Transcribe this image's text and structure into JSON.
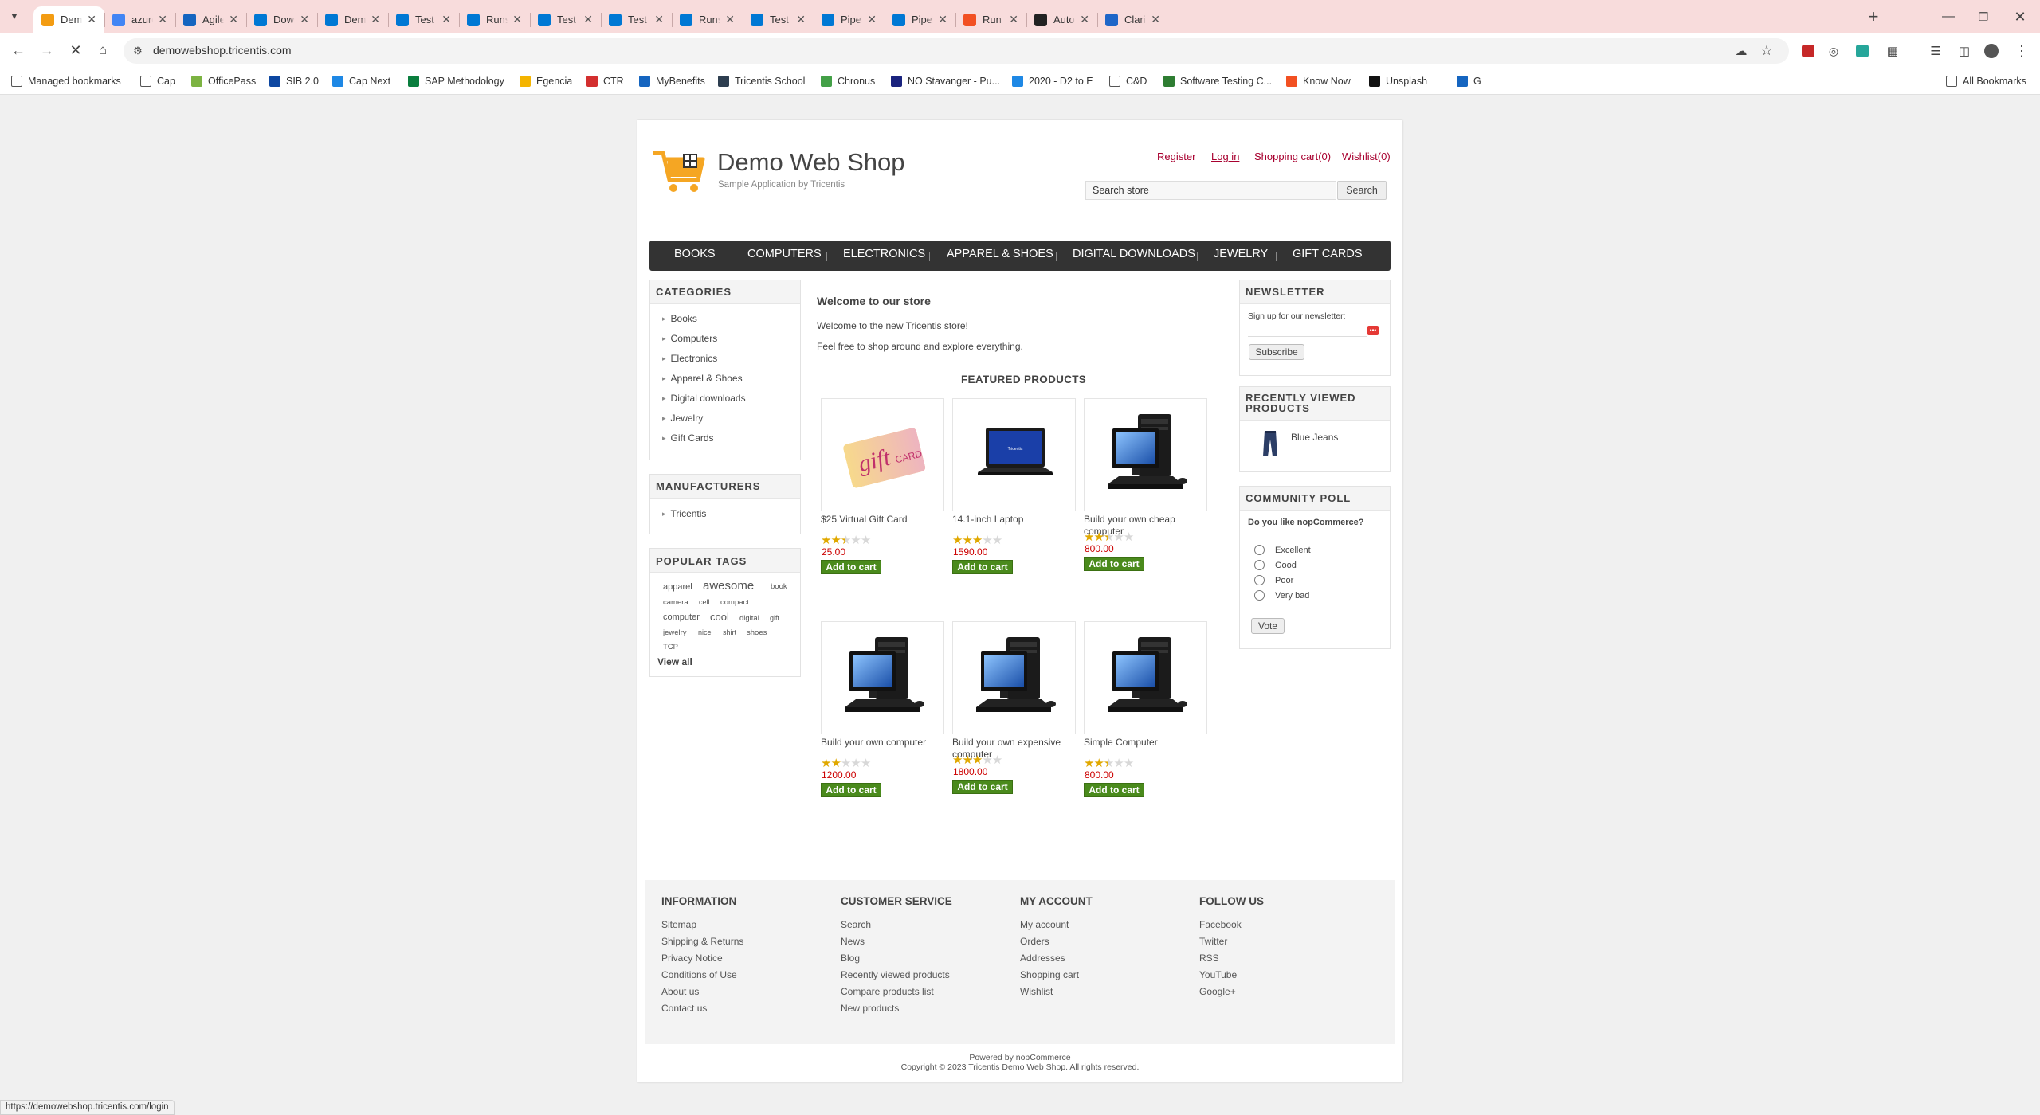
{
  "browser": {
    "tabs": [
      {
        "title": "Demo Web Shop",
        "icon": "shopping-cart-icon",
        "color": "#f39c12"
      },
      {
        "title": "azure devops",
        "icon": "google-icon",
        "color": "#4285f4"
      },
      {
        "title": "Agile Test Practices",
        "icon": "globe-icon",
        "color": "#1565c0"
      },
      {
        "title": "Download - Tricentis",
        "icon": "download-icon",
        "color": "#0078d4"
      },
      {
        "title": "Demo - Repos",
        "icon": "azure-devops-icon",
        "color": "#0078d4"
      },
      {
        "title": "Test plans - Tests",
        "icon": "azure-devops-icon",
        "color": "#0078d4"
      },
      {
        "title": "Runs - Test Plans",
        "icon": "azure-devops-icon",
        "color": "#0078d4"
      },
      {
        "title": "Test plans - Tests",
        "icon": "azure-devops-icon",
        "color": "#0078d4"
      },
      {
        "title": "Test plans - Tests",
        "icon": "azure-devops-icon",
        "color": "#0078d4"
      },
      {
        "title": "Runs - Test Plans",
        "icon": "azure-devops-icon",
        "color": "#0078d4"
      },
      {
        "title": "Test plans - Tests",
        "icon": "azure-devops-icon",
        "color": "#0078d4"
      },
      {
        "title": "Pipelines - Runs",
        "icon": "azure-devops-icon",
        "color": "#0078d4"
      },
      {
        "title": "Pipelines - Runs",
        "icon": "azure-devops-icon",
        "color": "#0078d4"
      },
      {
        "title": "Run automated tests",
        "icon": "microsoft-icon",
        "color": "#f25022"
      },
      {
        "title": "AutoTest/Demo",
        "icon": "github-icon",
        "color": "#222222"
      },
      {
        "title": "Clarity PPM",
        "icon": "clarity-icon",
        "color": "#1e66c8"
      }
    ],
    "url": "demowebshop.tricentis.com",
    "status_url": "https://demowebshop.tricentis.com/login",
    "bookmarks": [
      {
        "label": "Managed bookmarks",
        "icon": "folder-icon",
        "color": "#555555"
      },
      {
        "label": "Cap",
        "icon": "folder-icon",
        "color": "#555555"
      },
      {
        "label": "OfficePass",
        "icon": "officepass-icon",
        "color": "#7cb342"
      },
      {
        "label": "SIB 2.0",
        "icon": "sib-icon",
        "color": "#0d47a1"
      },
      {
        "label": "Cap Next",
        "icon": "cap-next-icon",
        "color": "#1e88e5"
      },
      {
        "label": "SAP Methodology",
        "icon": "sap-icon",
        "color": "#0a7e3e"
      },
      {
        "label": "Egencia",
        "icon": "egencia-icon",
        "color": "#f4b400"
      },
      {
        "label": "CTR",
        "icon": "ctr-icon",
        "color": "#d32f2f"
      },
      {
        "label": "MyBenefits",
        "icon": "mybenefits-icon",
        "color": "#1565c0"
      },
      {
        "label": "Tricentis School",
        "icon": "tricentis-icon",
        "color": "#2d3e50"
      },
      {
        "label": "Chronus",
        "icon": "chronus-icon",
        "color": "#43a047"
      },
      {
        "label": "NO Stavanger - Pu...",
        "icon": "no-icon",
        "color": "#1a237e"
      },
      {
        "label": "2020 - D2 to E",
        "icon": "cloud-icon",
        "color": "#1e88e5"
      },
      {
        "label": "C&D",
        "icon": "folder-icon",
        "color": "#555555"
      },
      {
        "label": "Software Testing C...",
        "icon": "software-testing-icon",
        "color": "#2e7d32"
      },
      {
        "label": "Know Now",
        "icon": "microsoft-icon",
        "color": "#f25022"
      },
      {
        "label": "Unsplash",
        "icon": "unsplash-icon",
        "color": "#111111"
      },
      {
        "label": "G",
        "icon": "salesforce-icon",
        "color": "#1565c0"
      }
    ],
    "all_bookmarks": "All Bookmarks"
  },
  "header": {
    "shop_title": "Demo Web Shop",
    "shop_subtitle": "Sample Application by Tricentis",
    "links": {
      "register": "Register",
      "login": "Log in",
      "cart": "Shopping cart(0)",
      "wishlist": "Wishlist(0)"
    },
    "search_value": "Search store",
    "search_button": "Search"
  },
  "nav": [
    "BOOKS",
    "COMPUTERS",
    "ELECTRONICS",
    "APPAREL & SHOES",
    "DIGITAL DOWNLOADS",
    "JEWELRY",
    "GIFT CARDS"
  ],
  "categories": {
    "title": "CATEGORIES",
    "items": [
      "Books",
      "Computers",
      "Electronics",
      "Apparel & Shoes",
      "Digital downloads",
      "Jewelry",
      "Gift Cards"
    ]
  },
  "manufacturers": {
    "title": "MANUFACTURERS",
    "items": [
      "Tricentis"
    ]
  },
  "popular_tags": {
    "title": "POPULAR TAGS",
    "tags": [
      "apparel",
      "awesome",
      "book",
      "camera",
      "cell",
      "compact",
      "computer",
      "cool",
      "digital",
      "gift",
      "jewelry",
      "nice",
      "shirt",
      "shoes",
      "TCP"
    ],
    "view_all": "View all"
  },
  "welcome": {
    "title": "Welcome to our store",
    "line1": "Welcome to the new Tricentis store!",
    "line2": "Feel free to shop around and explore everything."
  },
  "featured": {
    "title": "FEATURED PRODUCTS",
    "add_to_cart": "Add to cart",
    "products": [
      {
        "name": "$25 Virtual Gift Card",
        "price": "25.00",
        "rating": 2.5,
        "image": "gift-card-icon"
      },
      {
        "name": "14.1-inch Laptop",
        "price": "1590.00",
        "rating": 3,
        "image": "laptop-icon"
      },
      {
        "name": "Build your own cheap computer",
        "price": "800.00",
        "rating": 2.5,
        "image": "desktop-computer-icon"
      },
      {
        "name": "Build your own computer",
        "price": "1200.00",
        "rating": 2,
        "image": "desktop-computer-icon"
      },
      {
        "name": "Build your own expensive computer",
        "price": "1800.00",
        "rating": 3,
        "image": "desktop-computer-icon"
      },
      {
        "name": "Simple Computer",
        "price": "800.00",
        "rating": 2.5,
        "image": "desktop-computer-icon"
      }
    ]
  },
  "newsletter": {
    "title": "NEWSLETTER",
    "label": "Sign up for our newsletter:",
    "subscribe": "Subscribe"
  },
  "recently_viewed": {
    "title": "RECENTLY VIEWED PRODUCTS",
    "items": [
      "Blue Jeans"
    ]
  },
  "poll": {
    "title": "COMMUNITY POLL",
    "question": "Do you like nopCommerce?",
    "options": [
      "Excellent",
      "Good",
      "Poor",
      "Very bad"
    ],
    "vote": "Vote"
  },
  "footer": {
    "columns": [
      {
        "title": "INFORMATION",
        "links": [
          "Sitemap",
          "Shipping & Returns",
          "Privacy Notice",
          "Conditions of Use",
          "About us",
          "Contact us"
        ]
      },
      {
        "title": "CUSTOMER SERVICE",
        "links": [
          "Search",
          "News",
          "Blog",
          "Recently viewed products",
          "Compare products list",
          "New products"
        ]
      },
      {
        "title": "MY ACCOUNT",
        "links": [
          "My account",
          "Orders",
          "Addresses",
          "Shopping cart",
          "Wishlist"
        ]
      },
      {
        "title": "FOLLOW US",
        "links": [
          "Facebook",
          "Twitter",
          "RSS",
          "YouTube",
          "Google+"
        ]
      }
    ],
    "powered_by": "Powered by nopCommerce",
    "copyright": "Copyright © 2023 Tricentis Demo Web Shop. All rights reserved."
  },
  "colors": {
    "accent": "#a8002f",
    "nav_bg": "#333333",
    "add_to_cart": "#4a8a1c",
    "price": "#cc0000",
    "star": "#e0a800",
    "tab_strip": "#f8dcdc"
  }
}
